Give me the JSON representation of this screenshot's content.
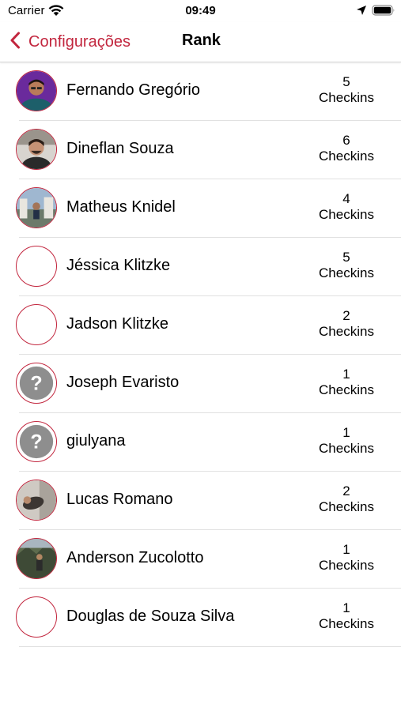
{
  "status_bar": {
    "carrier": "Carrier",
    "time": "09:49",
    "icons": [
      "wifi-icon",
      "location-arrow-icon",
      "battery-icon"
    ]
  },
  "nav": {
    "back_label": "Configurações",
    "title": "Rank",
    "accent_color": "#c2263e"
  },
  "rank": [
    {
      "name": "Fernando Gregório",
      "count": "5",
      "unit": "Checkins",
      "avatar": "photo"
    },
    {
      "name": "Dineflan Souza",
      "count": "6",
      "unit": "Checkins",
      "avatar": "photo"
    },
    {
      "name": "Matheus Knidel",
      "count": "4",
      "unit": "Checkins",
      "avatar": "photo"
    },
    {
      "name": "Jéssica Klitzke",
      "count": "5",
      "unit": "Checkins",
      "avatar": "empty"
    },
    {
      "name": "Jadson Klitzke",
      "count": "2",
      "unit": "Checkins",
      "avatar": "empty"
    },
    {
      "name": "Joseph Evaristo",
      "count": "1",
      "unit": "Checkins",
      "avatar": "question-mark"
    },
    {
      "name": "giulyana",
      "count": "1",
      "unit": "Checkins",
      "avatar": "question-mark"
    },
    {
      "name": "Lucas Romano",
      "count": "2",
      "unit": "Checkins",
      "avatar": "photo"
    },
    {
      "name": "Anderson Zucolotto",
      "count": "1",
      "unit": "Checkins",
      "avatar": "photo"
    },
    {
      "name": "Douglas de Souza Silva",
      "count": "1",
      "unit": "Checkins",
      "avatar": "empty"
    }
  ]
}
